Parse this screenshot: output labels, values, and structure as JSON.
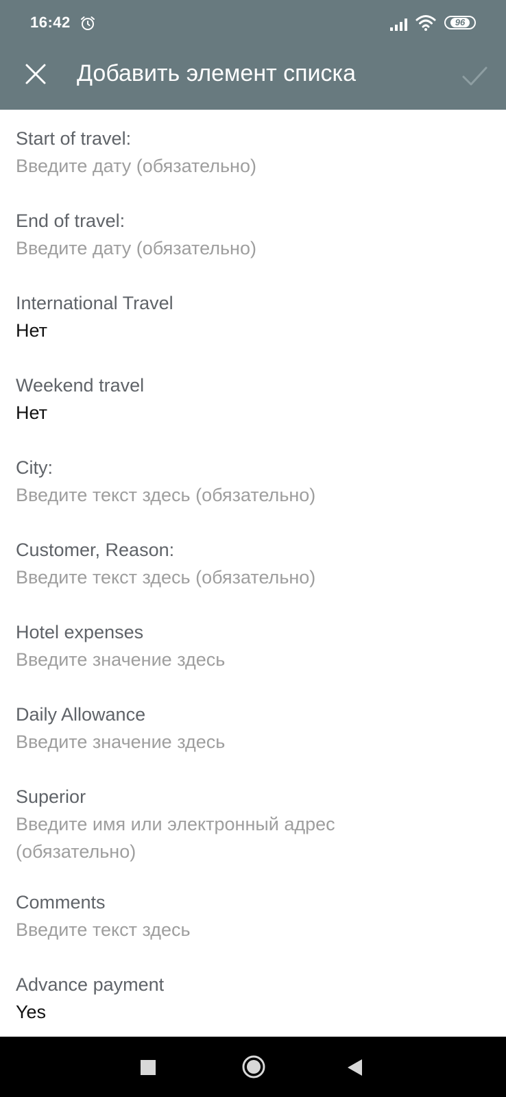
{
  "status_bar": {
    "time": "16:42",
    "battery": "96"
  },
  "app_bar": {
    "title": "Добавить элемент списка"
  },
  "fields": [
    {
      "label": "Start of travel:",
      "value": "Введите дату (обязательно)"
    },
    {
      "label": "End of travel:",
      "value": "Введите дату (обязательно)"
    },
    {
      "label": "International Travel",
      "value": "Нет"
    },
    {
      "label": "Weekend travel",
      "value": "Нет"
    },
    {
      "label": "City:",
      "value": "Введите текст здесь (обязательно)"
    },
    {
      "label": "Customer, Reason:",
      "value": "Введите текст здесь (обязательно)"
    },
    {
      "label": "Hotel expenses",
      "value": "Введите значение здесь"
    },
    {
      "label": "Daily Allowance",
      "value": "Введите значение здесь"
    },
    {
      "label": "Superior",
      "value": "Введите имя или электронный адрес (обязательно)"
    },
    {
      "label": "Comments",
      "value": "Введите текст здесь"
    },
    {
      "label": "Advance payment",
      "value": "Yes"
    }
  ],
  "colors": {
    "header": "#687a7f",
    "label": "#5f6368",
    "placeholder": "#9e9e9e",
    "value": "#111111",
    "nav_bar": "#000000"
  },
  "icons": {
    "status": [
      "alarm-icon",
      "signal-icon",
      "wifi-icon",
      "battery-icon"
    ],
    "app_bar": [
      "close-icon",
      "check-icon"
    ],
    "nav": [
      "recents-square-icon",
      "home-circle-icon",
      "back-triangle-icon"
    ]
  }
}
